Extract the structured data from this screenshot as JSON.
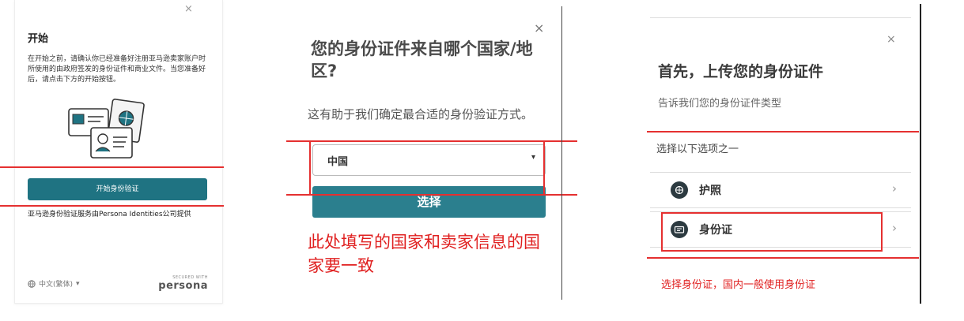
{
  "panel1": {
    "close_icon": "×",
    "title": "开始",
    "description": "在开始之前，请确认你已经准备好注册亚马逊卖家账户时所使用的由政府签发的身份证件和商业文件。当您准备好后，请点击下方的开始按钮。",
    "illustration": "id-documents-illustration",
    "start_button": "开始身份验证",
    "footer_text": "亚马逊身份验证服务由Persona Identities公司提供",
    "language": "中文(繁体)",
    "language_caret": "▾",
    "secured_with": "SECURED WITH",
    "brand": "persona"
  },
  "panel2": {
    "close_icon": "×",
    "title": "您的身份证件来自哪个国家/地区?",
    "subtitle": "这有助于我们确定最合适的身份验证方式。",
    "country_select": {
      "value": "中国",
      "caret": "▾"
    },
    "select_button": "选择",
    "annotation": "此处填写的国家和卖家信息的国家要一致"
  },
  "panel3": {
    "close_icon": "×",
    "title": "首先，上传您的身份证件",
    "subtitle": "告诉我们您的身份证件类型",
    "prompt": "选择以下选项之一",
    "options": [
      {
        "label": "护照",
        "icon": "passport-icon",
        "chevron": "›"
      },
      {
        "label": "身份证",
        "icon": "id-card-icon",
        "chevron": "›"
      }
    ],
    "annotation": "选择身份证，国内一般使用身份证"
  },
  "colors": {
    "teal_button": "#1f7382",
    "annotation_red": "#e53030"
  }
}
